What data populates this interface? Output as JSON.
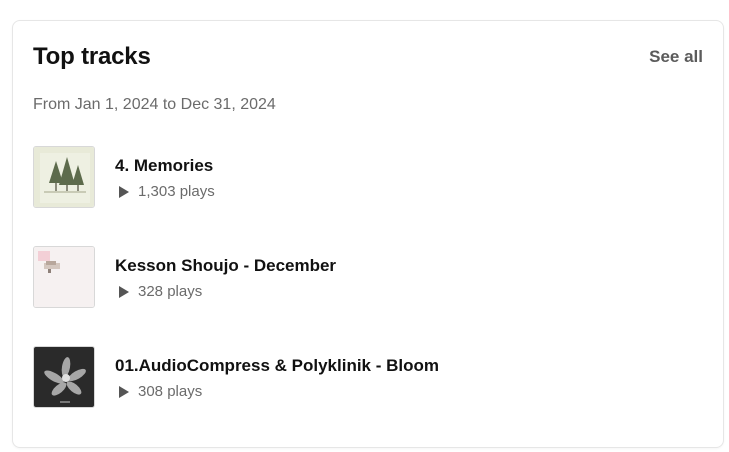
{
  "widget": {
    "title": "Top tracks",
    "see_all_label": "See all",
    "date_range": "From Jan 1, 2024 to Dec 31, 2024"
  },
  "tracks": [
    {
      "name": "4. Memories",
      "plays": "1,303 plays",
      "art_icon": "forest-artwork"
    },
    {
      "name": "Kesson Shoujo - December",
      "plays": "328 plays",
      "art_icon": "pink-artwork"
    },
    {
      "name": "01.AudioCompress & Polyklinik - Bloom",
      "plays": "308 plays",
      "art_icon": "dark-flower-artwork"
    }
  ],
  "colors": {
    "border": "#e6e6e6",
    "title": "#111111",
    "muted": "#6b6b6b"
  }
}
